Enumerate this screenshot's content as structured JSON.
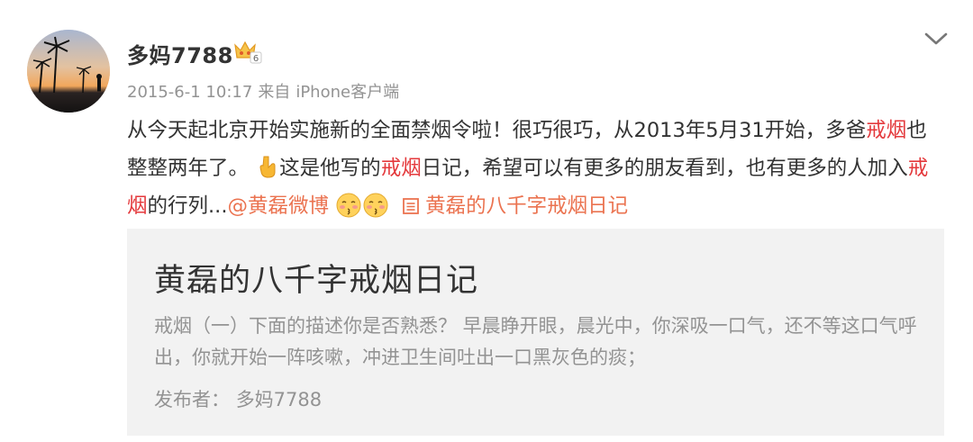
{
  "post": {
    "username": "多妈7788",
    "vip_level": "6",
    "timestamp": "2015-6-1 10:17",
    "source_prefix": "来自",
    "source": "iPhone客户端",
    "text": {
      "seg1": "从今天起北京开始实施新的全面禁烟令啦！很巧很巧，从2013年5月31开始，多爸",
      "kw1": "戒烟",
      "seg2": "也整整两年了。",
      "seg3": "这是他写的",
      "kw2": "戒烟",
      "seg4": "日记，希望可以有更多的朋友看到，也有更多的人加入",
      "kw3": "戒烟",
      "seg5": "的行列...",
      "mention": "@黄磊微博",
      "article_link": "黄磊的八千字戒烟日记"
    },
    "icons": {
      "pointing": "pointing-down-icon",
      "kiss": "kiss-icon",
      "article": "article-icon",
      "dropdown": "chevron-down-icon",
      "vip": "vip-crown-icon"
    }
  },
  "card": {
    "title": "黄磊的八千字戒烟日记",
    "summary": "戒烟（一）下面的描述你是否熟悉？ 早晨睁开眼，晨光中，你深吸一口气，还不等这口气呼出，你就开始一阵咳嗽，冲进卫生间吐出一口黑灰色的痰；",
    "publisher_label": "发布者：",
    "publisher": "多妈7788"
  },
  "colors": {
    "keyword": "#e4393c",
    "link": "#eb7350",
    "meta": "#939393",
    "card_bg": "#f2f2f2"
  }
}
